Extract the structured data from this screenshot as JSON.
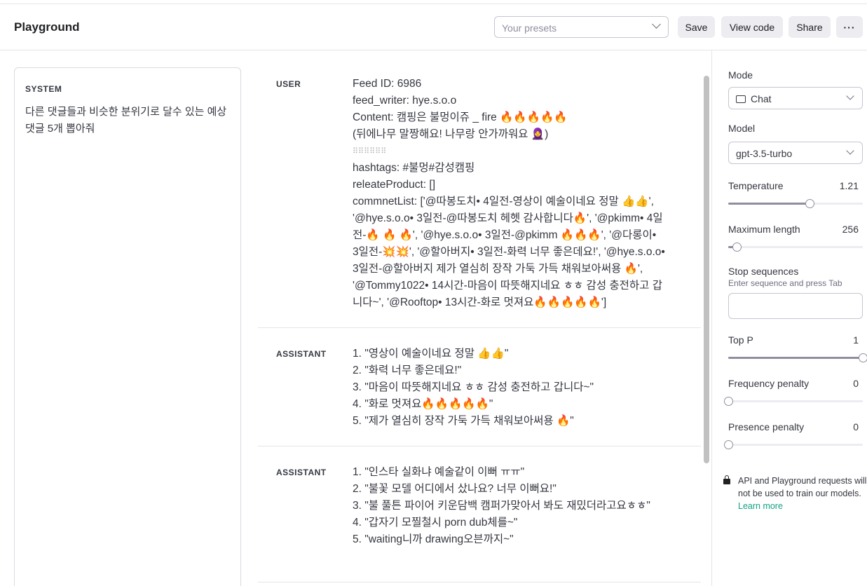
{
  "header": {
    "title": "Playground",
    "presets_placeholder": "Your presets",
    "save_label": "Save",
    "view_code_label": "View code",
    "share_label": "Share",
    "more_label": "···"
  },
  "system": {
    "label": "SYSTEM",
    "text": "다른 댓글들과 비슷한 분위기로 달수 있는 예상 댓글 5개 뽑아줘"
  },
  "messages": [
    {
      "role": "USER",
      "lines": [
        "Feed ID: 6986",
        "feed_writer: hye.s.o.o",
        "Content: 캠핑은 불멍이쥬 _ fire 🔥🔥🔥🔥🔥",
        "(뒤에나무 말짱해요! 나무랑 안가까워요 🧕)",
        "⠿⠿⠿⠿⠿⠿",
        "hashtags: #불멍#감성캠핑",
        "releateProduct: []",
        "commnetList: ['@따봉도치• 4일전-영상이 예술이네요 정말 👍👍',",
        "'@hye.s.o.o• 3일전-@따봉도치 헤헷 감사합니다🔥', '@pkimm• 4일",
        "전-🔥 🔥 🔥', '@hye.s.o.o• 3일전-@pkimm 🔥🔥🔥', '@다롱이•",
        "3일전-💥💥', '@할아버지• 3일전-화력 너무 좋은데요!', '@hye.s.o.o•",
        "3일전-@할아버지 제가 열심히 장작 가둑 가득 채워보아써용 🔥',",
        "'@Tommy1022• 14시간-마음이 따뜻해지네요 ㅎㅎ 감성 충전하고 갑",
        "니다~', '@Rooftop• 13시간-화로 멋져요🔥🔥🔥🔥🔥']"
      ]
    },
    {
      "role": "ASSISTANT",
      "lines": [
        "1. \"영상이 예술이네요 정말 👍👍\"",
        "2. \"화력 너무 좋은데요!\"",
        "3. \"마음이 따뜻해지네요 ㅎㅎ 감성 충전하고 갑니다~\"",
        "4. \"화로 멋져요🔥🔥🔥🔥🔥\"",
        "5. \"제가 열심히 장작 가둑 가득 채워보아써용 🔥\""
      ]
    },
    {
      "role": "ASSISTANT",
      "lines": [
        "1. \"인스타 실화냐 예술같이 이뻐 ㅠㅠ\"",
        "2. \"불꽃 모델 어디에서 샀나요? 너무 이뻐요!\"",
        "3. \"불 풀튼 파이어 키운담백 캠퍼가맞아서 봐도 재밌더라고요ㅎㅎ\"",
        "4. \"갑자기 모찔철시 porn dub체를~\"",
        "5. \"waiting니까 drawing오븐까지~\""
      ]
    }
  ],
  "sidebar": {
    "mode_label": "Mode",
    "mode_value": "Chat",
    "model_label": "Model",
    "model_value": "gpt-3.5-turbo",
    "temperature_label": "Temperature",
    "temperature_value": "1.21",
    "temperature_fraction": 0.605,
    "max_length_label": "Maximum length",
    "max_length_value": "256",
    "max_length_fraction": 0.063,
    "stop_label": "Stop sequences",
    "stop_hint": "Enter sequence and press Tab",
    "top_p_label": "Top P",
    "top_p_value": "1",
    "top_p_fraction": 1.0,
    "freq_label": "Frequency penalty",
    "freq_value": "0",
    "freq_fraction": 0.0,
    "presence_label": "Presence penalty",
    "presence_value": "0",
    "presence_fraction": 0.0,
    "notice_text": "API and Playground requests will not be used to train our models.",
    "learn_more": "Learn more"
  }
}
